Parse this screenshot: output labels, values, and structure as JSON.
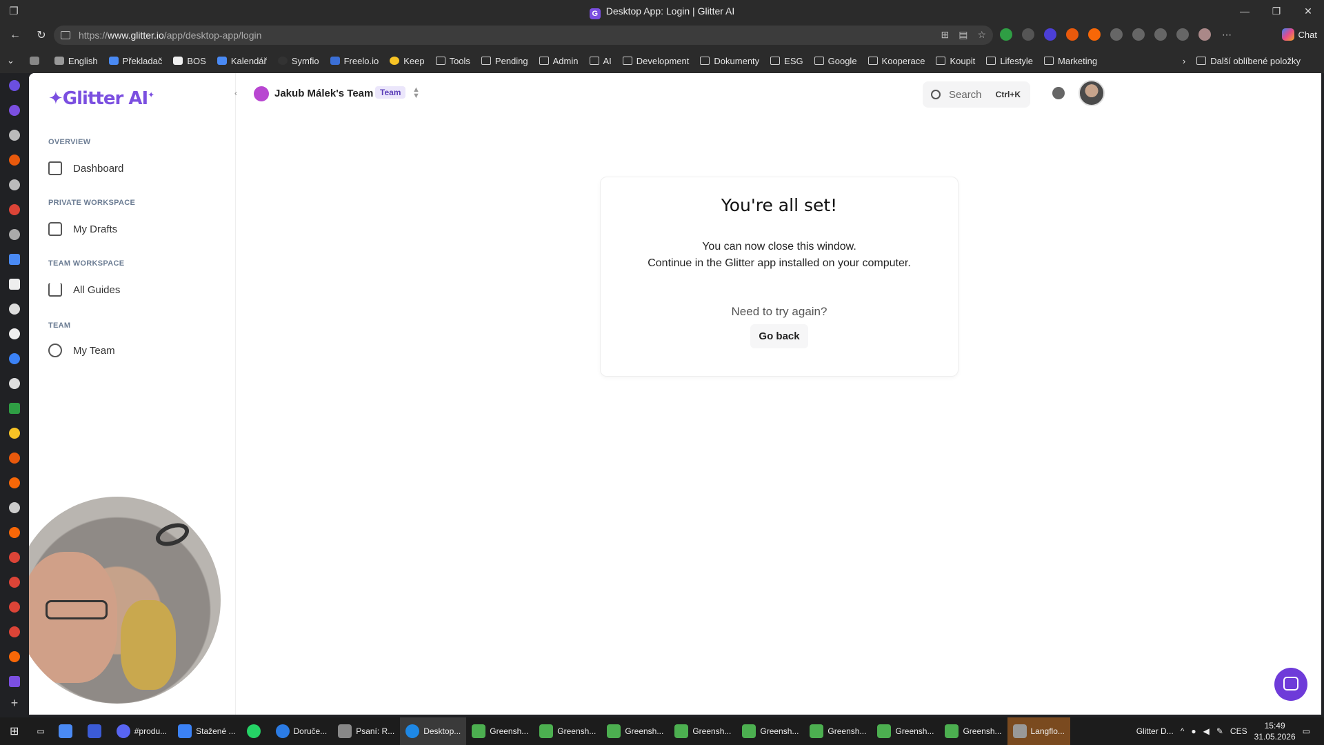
{
  "window": {
    "title": "Desktop App: Login | Glitter AI"
  },
  "address": {
    "prefix": "https://",
    "domain": "www.glitter.io",
    "path": "/app/desktop-app/login"
  },
  "chat_label": "Chat",
  "bookmarks": [
    "English",
    "Překladač",
    "BOS",
    "Kalendář",
    "Symfio",
    "Freelo.io",
    "Keep",
    "Tools",
    "Pending",
    "Admin",
    "AI",
    "Development",
    "Dokumenty",
    "ESG",
    "Google",
    "Kooperace",
    "Koupit",
    "Lifestyle",
    "Marketing"
  ],
  "bookmarks_other": "Další oblíbené položky",
  "brand": {
    "logo": "Glitter AI",
    "accent": "#7b4fe0"
  },
  "sidebar": {
    "sections": [
      {
        "title": "OVERVIEW",
        "item": "Dashboard"
      },
      {
        "title": "PRIVATE WORKSPACE",
        "item": "My Drafts"
      },
      {
        "title": "TEAM WORKSPACE",
        "item": "All Guides"
      },
      {
        "title": "TEAM",
        "item": "My Team"
      }
    ]
  },
  "header": {
    "team_name": "Jakub Málek's Team",
    "team_badge": "Team",
    "search": "Search",
    "shortcut": "Ctrl+K"
  },
  "card": {
    "title": "You're all set!",
    "line1": "You can now close this window.",
    "line2": "Continue in the Glitter app installed on your computer.",
    "retry": "Need to try again?",
    "button": "Go back"
  },
  "taskbar": {
    "items": [
      "#produ...",
      "Stažené ...",
      "",
      "Doruče...",
      "Psaní: R...",
      "Desktop...",
      "Greensh...",
      "Greensh...",
      "Greensh...",
      "Greensh...",
      "Greensh...",
      "Greensh...",
      "Greensh...",
      "Greensh...",
      "Langflo...",
      "Glitter D..."
    ],
    "lang": "CES",
    "time": "15:49",
    "date": "31.05.2026"
  }
}
